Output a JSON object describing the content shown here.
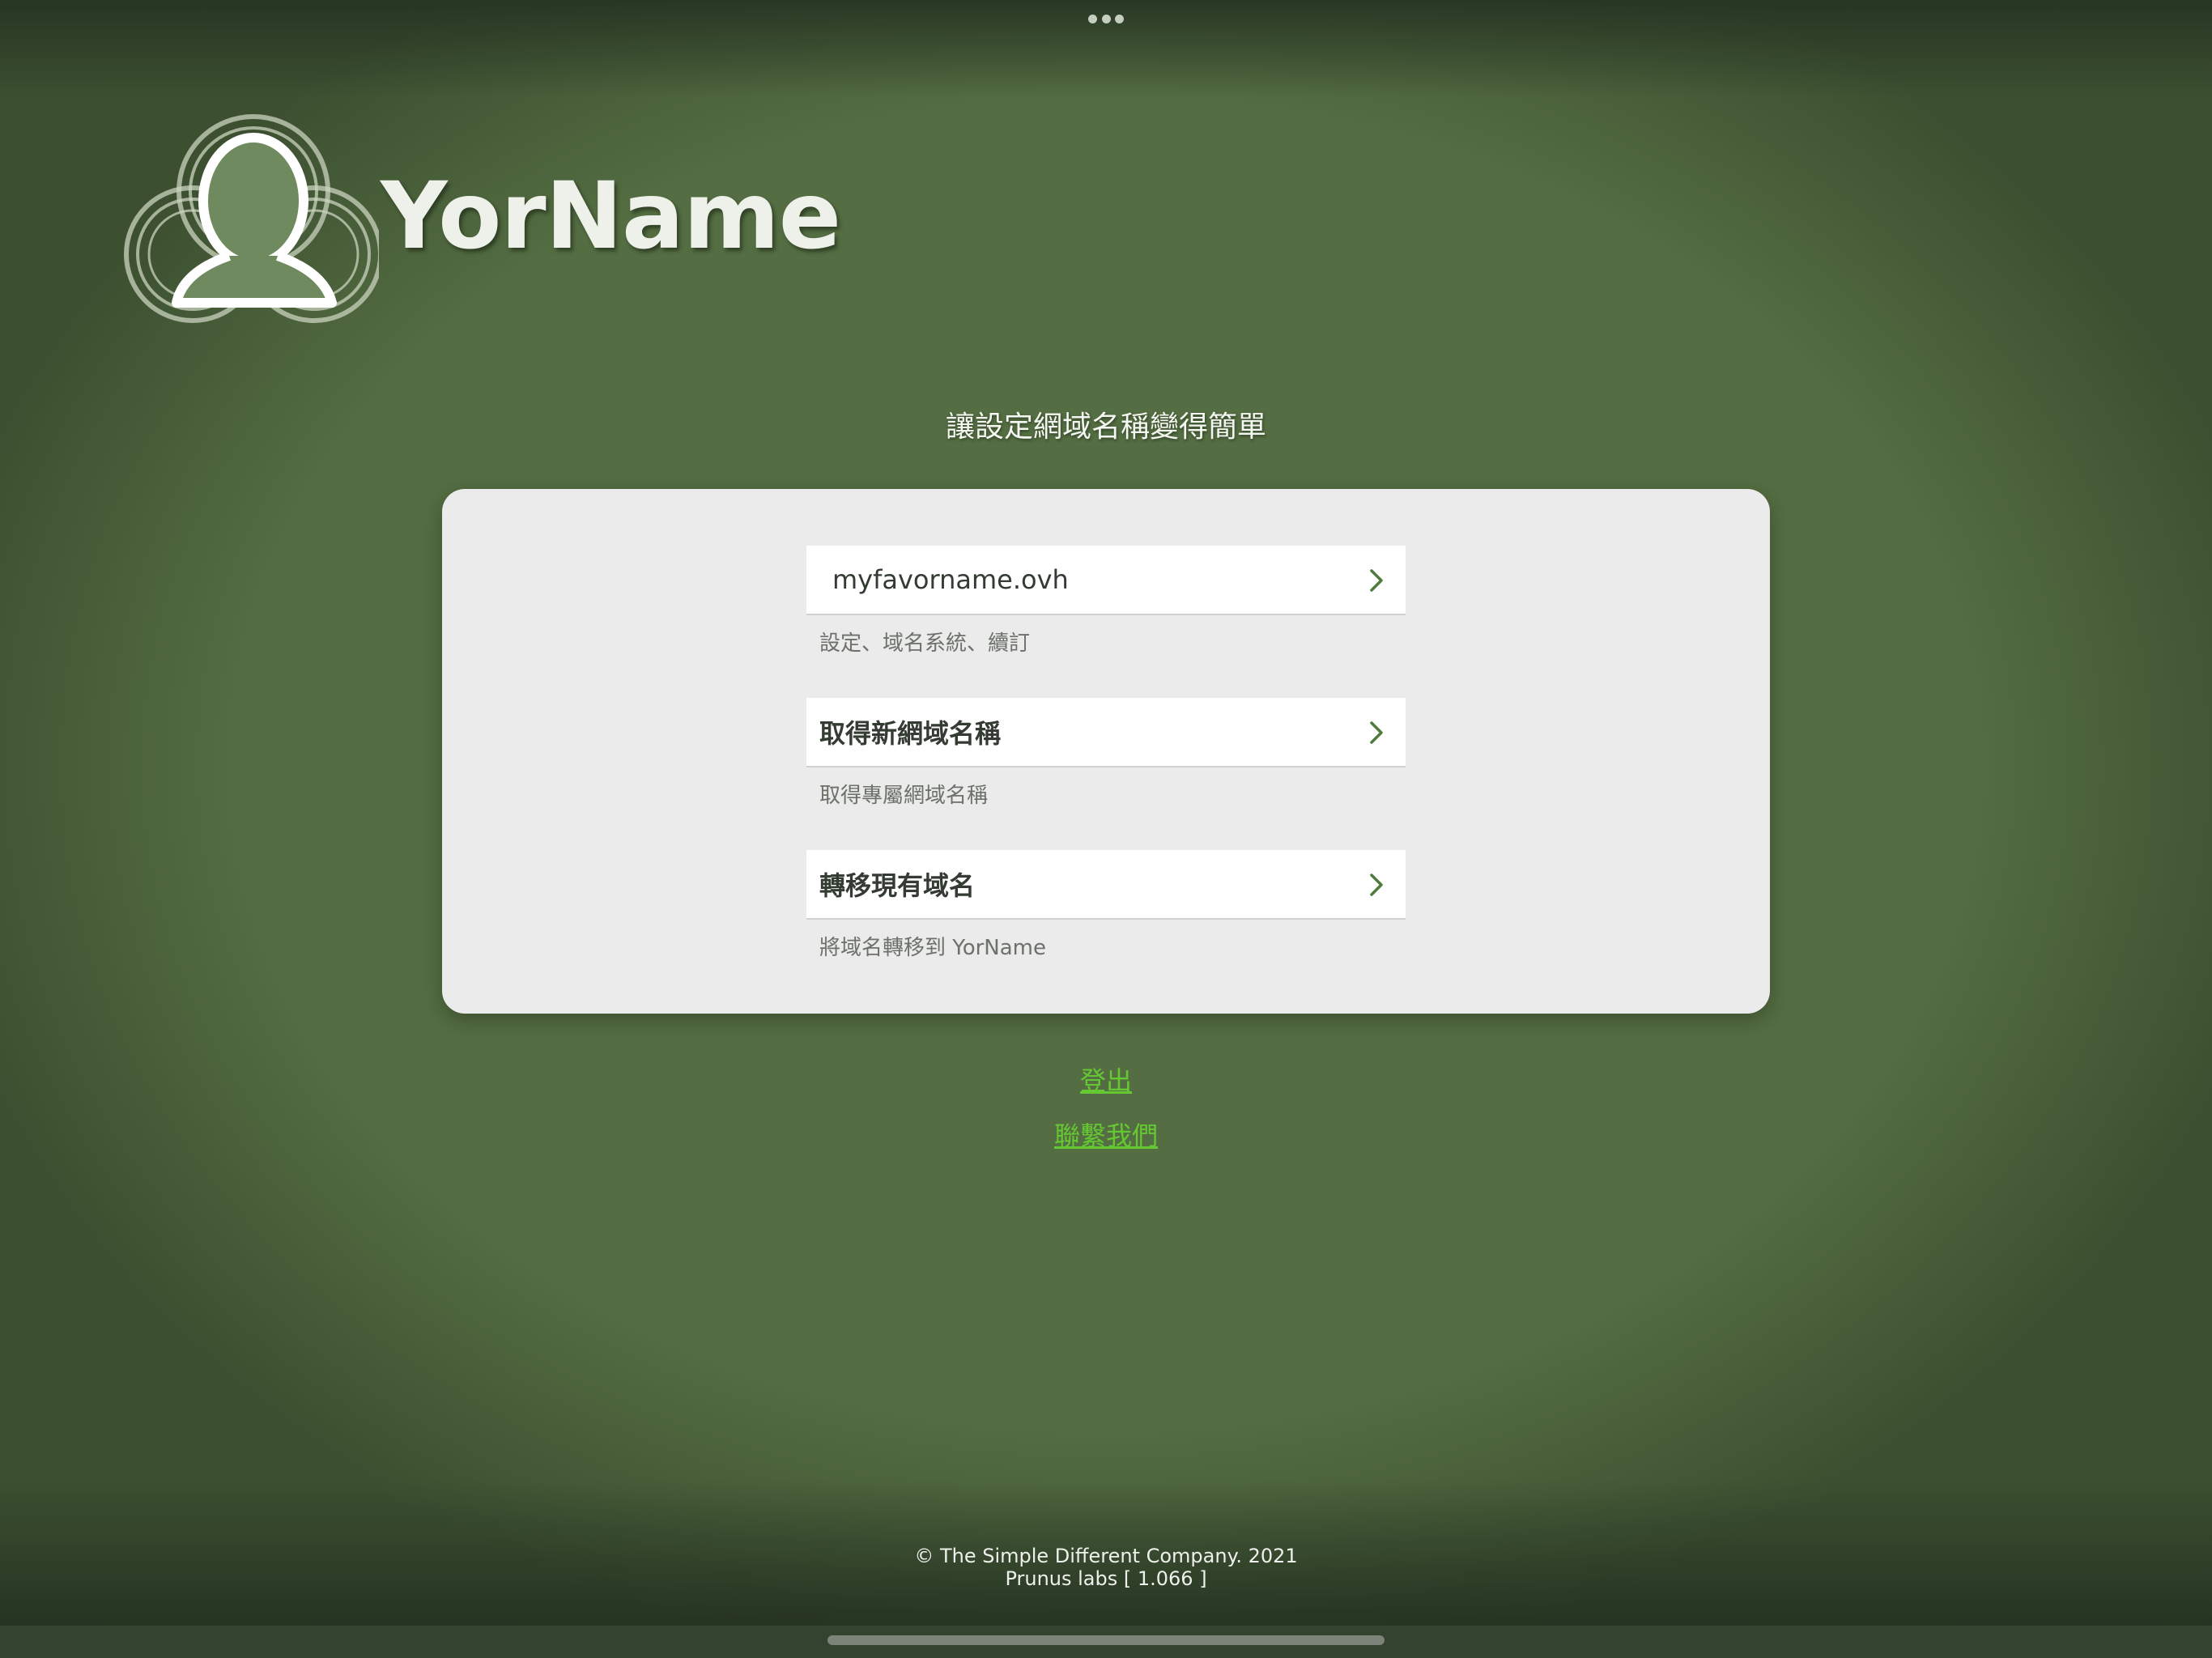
{
  "brand": {
    "name": "YorName"
  },
  "tagline": "讓設定網域名稱變得簡單",
  "menu": {
    "items": [
      {
        "label": "myfavorname.ovh",
        "subtitle": "設定、域名系統、續訂"
      },
      {
        "label": "取得新網域名稱",
        "subtitle": "取得專屬網域名稱"
      },
      {
        "label": "轉移現有域名",
        "subtitle": "將域名轉移到 YorName"
      }
    ]
  },
  "links": {
    "logout": "登出",
    "contact": "聯繫我們"
  },
  "footer": {
    "copyright": "© The Simple Different Company. 2021",
    "version": "Prunus labs [ 1.066 ]"
  },
  "icons": {
    "row_action": "chevron-right-icon",
    "logo": "person-knot-logo-icon"
  },
  "colors": {
    "background": "#546d42",
    "card": "#eaebea",
    "link": "#64c832",
    "chevron": "#4f7a3e"
  }
}
